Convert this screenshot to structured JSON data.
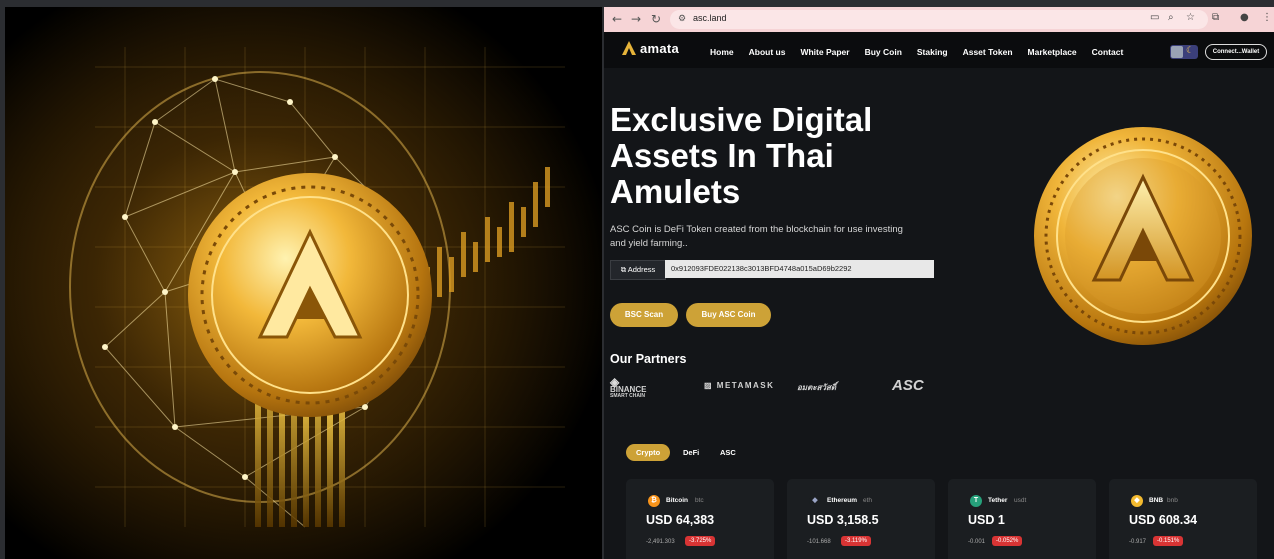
{
  "browser": {
    "url": "asc.land"
  },
  "site": {
    "logo_text": "amata",
    "nav": [
      "Home",
      "About us",
      "White Paper",
      "Buy Coin",
      "Staking",
      "Asset Token",
      "Marketplace",
      "Contact"
    ],
    "connect_label": "Connect...Wallet"
  },
  "hero": {
    "title": "Exclusive Digital Assets In Thai Amulets",
    "description": "ASC Coin is DeFi Token created from the blockchain for use investing and yield farming..",
    "address_label": "Address",
    "address_value": "0x912093FDE022138c3013BFD4748a015aD69b2292",
    "buttons": [
      "BSC Scan",
      "Buy ASC Coin"
    ]
  },
  "partners": {
    "title": "Our Partners",
    "logos": [
      {
        "line1": "BINANCE",
        "line2": "SMART CHAIN"
      },
      {
        "line1": "METAMASK"
      },
      {
        "line1": "อมตะสวัสดิ์"
      },
      {
        "line1": "ASC"
      }
    ]
  },
  "market": {
    "tabs": [
      "Crypto",
      "DeFi",
      "ASC"
    ],
    "active_tab": "Crypto",
    "coins": [
      {
        "name": "Bitcoin",
        "symbol": "btc",
        "price": "USD 64,383",
        "change": "-2,491.303",
        "percent": "-3.725%",
        "icon_color": "#f7931a",
        "icon": "₿"
      },
      {
        "name": "Ethereum",
        "symbol": "eth",
        "price": "USD 3,158.5",
        "change": "-101.668",
        "percent": "-3.119%",
        "icon_color": "#1b1e21",
        "icon": "◆"
      },
      {
        "name": "Tether",
        "symbol": "usdt",
        "price": "USD 1",
        "change": "-0.001",
        "percent": "-0.052%",
        "icon_color": "#26a17b",
        "icon": "T"
      },
      {
        "name": "BNB",
        "symbol": "bnb",
        "price": "USD 608.34",
        "change": "-0.917",
        "percent": "-0.151%",
        "icon_color": "#f3ba2f",
        "icon": "◆"
      }
    ]
  },
  "colors": {
    "accent": "#cda237",
    "negative": "#d83434",
    "page_bg": "#131518"
  }
}
